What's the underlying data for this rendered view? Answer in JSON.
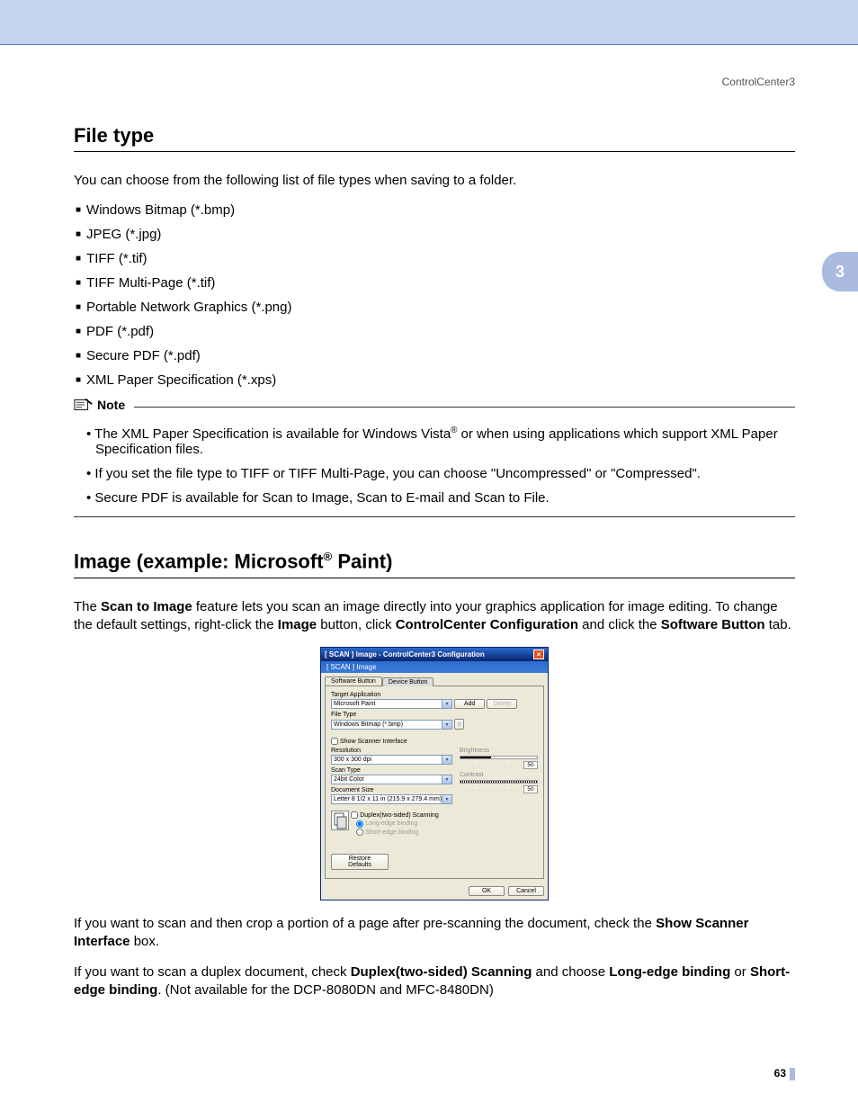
{
  "header": {
    "section": "ControlCenter3"
  },
  "side_tab": "3",
  "h_filetype": "File type",
  "filetype_intro": "You can choose from the following list of file types when saving to a folder.",
  "filetypes": [
    "Windows Bitmap (*.bmp)",
    "JPEG (*.jpg)",
    "TIFF (*.tif)",
    "TIFF Multi-Page (*.tif)",
    "Portable Network Graphics (*.png)",
    "PDF (*.pdf)",
    "Secure PDF (*.pdf)",
    "XML Paper Specification (*.xps)"
  ],
  "note_label": "Note",
  "notes": {
    "n1a": "The XML Paper Specification is available for Windows Vista",
    "n1b": " or when using applications which support XML Paper Specification files.",
    "n2": "If you set the file type to TIFF or TIFF Multi-Page, you can choose \"Uncompressed\" or \"Compressed\".",
    "n3": "Secure PDF is available for Scan to Image, Scan to E-mail and Scan to File."
  },
  "h_image_a": "Image (example: Microsoft",
  "h_image_b": " Paint)",
  "p_image": {
    "a": "The ",
    "b": "Scan to Image",
    "c": " feature lets you scan an image directly into your graphics application for image editing. To change the default settings, right-click the ",
    "d": "Image",
    "e": " button, click ",
    "f": "ControlCenter Configuration",
    "g": " and click the ",
    "h": "Software Button",
    "i": " tab."
  },
  "dialog": {
    "title": "[  SCAN  ]   Image - ControlCenter3 Configuration",
    "sub": "[ SCAN ]   Image",
    "tabs": {
      "active": "Software Button",
      "inactive": "Device Button"
    },
    "target_label": "Target Application",
    "target_value": "Microsoft Paint",
    "add": "Add",
    "delete": "Delete",
    "filetype_label": "File Type",
    "filetype_value": "Windows Bitmap (*.bmp)",
    "show_scanner": "Show Scanner Interface",
    "resolution_label": "Resolution",
    "resolution_value": "300 x 300 dpi",
    "scantype_label": "Scan Type",
    "scantype_value": "24bit Color",
    "docsize_label": "Document Size",
    "docsize_value": "Letter 8 1/2 x 11 in (215.9 x 279.4 mm)",
    "brightness": "Brightness",
    "contrast": "Contrast",
    "val50a": "50",
    "val50b": "50",
    "duplex": "Duplex(two-sided) Scanning",
    "long_edge": "Long-edge binding",
    "short_edge": "Short-edge binding",
    "restore": "Restore Defaults",
    "ok": "OK",
    "cancel": "Cancel"
  },
  "p_after1": {
    "a": "If you want to scan and then crop a portion of a page after pre-scanning the document, check the ",
    "b": "Show Scanner Interface",
    "c": " box."
  },
  "p_after2": {
    "a": "If you want to scan a duplex document, check ",
    "b": "Duplex(two-sided) Scanning",
    "c": " and choose ",
    "d": "Long-edge binding",
    "e": " or ",
    "f": "Short-edge binding",
    "g": ". (Not available for the DCP-8080DN and MFC-8480DN)"
  },
  "page_num": "63"
}
